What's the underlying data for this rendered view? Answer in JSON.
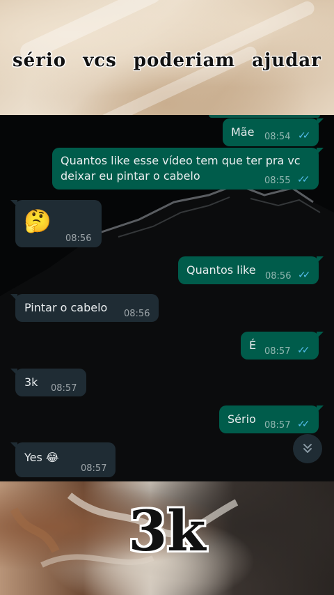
{
  "overlay": {
    "top_caption": "sério vcs poderiam ajudar",
    "bottom_caption": "3k"
  },
  "chat": {
    "messages": [
      {
        "direction": "out",
        "text": "Mãe",
        "time": "08:54",
        "ticks": "✓✓"
      },
      {
        "direction": "out",
        "text": "Quantos like esse vídeo tem que ter pra vc deixar eu pintar o cabelo",
        "time": "08:55",
        "ticks": "✓✓"
      },
      {
        "direction": "in",
        "text": "🤔",
        "time": "08:56"
      },
      {
        "direction": "out",
        "text": "Quantos like",
        "time": "08:56",
        "ticks": "✓✓"
      },
      {
        "direction": "in",
        "text": "Pintar o cabelo",
        "time": "08:56"
      },
      {
        "direction": "out",
        "text": "É",
        "time": "08:57",
        "ticks": "✓✓"
      },
      {
        "direction": "in",
        "text": "3k",
        "time": "08:57"
      },
      {
        "direction": "out",
        "text": "Sério",
        "time": "08:57",
        "ticks": "✓✓"
      },
      {
        "direction": "in",
        "text": "Yes 😂",
        "time": "08:57"
      }
    ],
    "scroll_down_icon": "double-chevron-down-icon"
  },
  "colors": {
    "outgoing_bubble": "#005c4b",
    "incoming_bubble": "#1f2c34",
    "read_ticks": "#53bdeb",
    "chat_background": "#050607"
  }
}
